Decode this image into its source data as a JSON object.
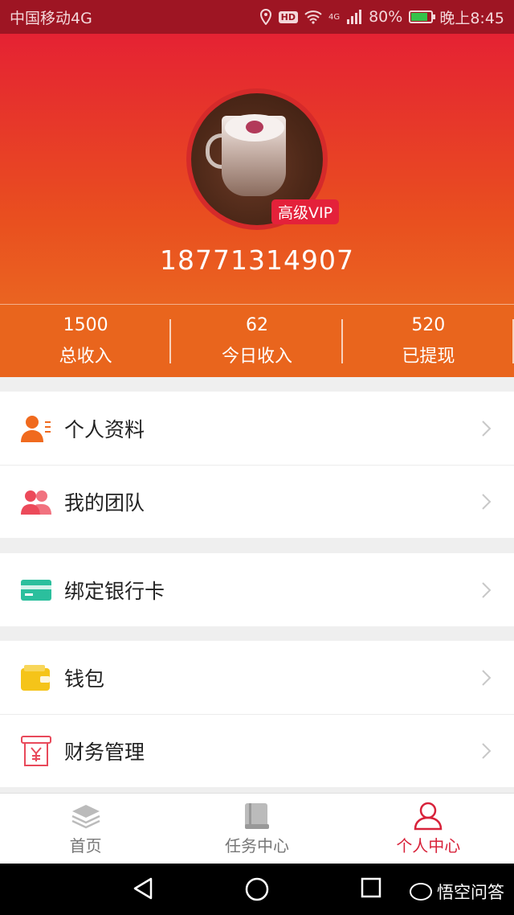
{
  "status_bar": {
    "carrier": "中国移动4G",
    "signal_label": "4G",
    "battery": "80%",
    "time": "晚上8:45",
    "hd": "HD"
  },
  "profile": {
    "vip_badge": "高级VIP",
    "phone": "18771314907"
  },
  "stats": [
    {
      "value": "1500",
      "label": "总收入"
    },
    {
      "value": "62",
      "label": "今日收入"
    },
    {
      "value": "520",
      "label": "已提现"
    }
  ],
  "menu": {
    "profile": "个人资料",
    "team": "我的团队",
    "bind_card": "绑定银行卡",
    "wallet": "钱包",
    "finance": "财务管理"
  },
  "tabs": [
    {
      "label": "首页",
      "icon": "layers-icon"
    },
    {
      "label": "任务中心",
      "icon": "book-icon"
    },
    {
      "label": "个人中心",
      "icon": "person-icon"
    }
  ],
  "colors": {
    "accent": "#d8223a",
    "header_top": "#e52233",
    "header_bottom": "#ea6421",
    "stats_bg": "#e9651d"
  },
  "watermark": "悟空问答"
}
